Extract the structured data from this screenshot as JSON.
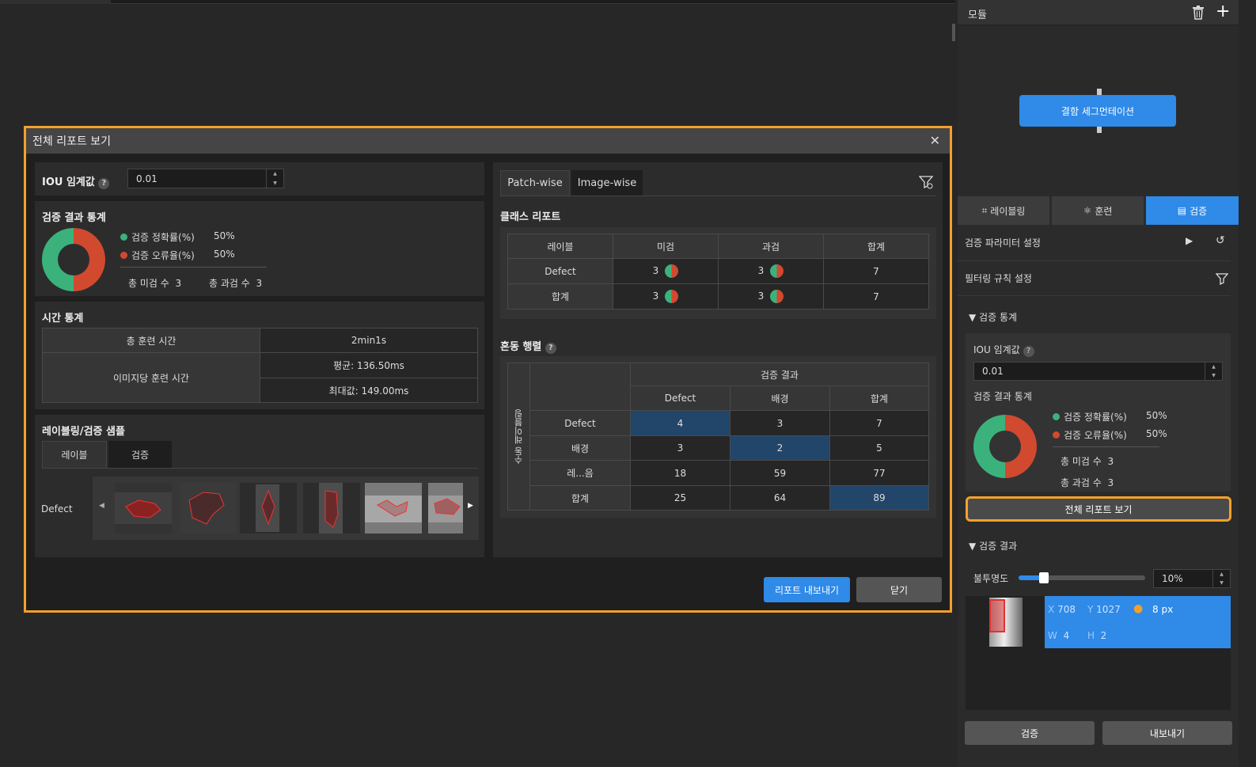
{
  "right_panel": {
    "title": "모듈",
    "node_label": "결함 세그먼테이션",
    "tabs": [
      {
        "label": "레이블링",
        "icon": "labeling-icon"
      },
      {
        "label": "훈련",
        "icon": "training-icon"
      },
      {
        "label": "검증",
        "icon": "validation-icon"
      }
    ],
    "param_setting": "검증 파라미터 설정",
    "filter_setting": "필터링 규칙 설정",
    "stats_section": "검증 통계",
    "iou_label": "IOU 임계값",
    "iou_value": "0.01",
    "result_stats": "검증 결과 통계",
    "accuracy_label": "검증 정확률(%)",
    "accuracy_value": "50%",
    "error_label": "검증 오류율(%)",
    "error_value": "50%",
    "miss_label": "총 미검 수",
    "miss_value": "3",
    "over_label": "총 과검 수",
    "over_value": "3",
    "full_report_button": "전체 리포트 보기",
    "results_section": "검증 결과",
    "opacity_label": "불투명도",
    "opacity_value": "10%",
    "opacity_fraction": 0.1,
    "detail": {
      "x_label": "X",
      "x": "708",
      "y_label": "Y",
      "y": "1027",
      "size": "8 px",
      "w_label": "W",
      "w": "4",
      "h_label": "H",
      "h": "2"
    },
    "validate_button": "검증",
    "export_button": "내보내기"
  },
  "dialog": {
    "title": "전체 리포트 보기",
    "iou_label": "IOU 임계값",
    "iou_value": "0.01",
    "result_stats_title": "검증 결과 통계",
    "accuracy_label": "검증 정확률(%)",
    "accuracy_value": "50%",
    "error_label": "검증 오류율(%)",
    "error_value": "50%",
    "miss_label": "총 미검 수",
    "miss_value": "3",
    "over_label": "총 과검 수",
    "over_value": "3",
    "time_title": "시간 통계",
    "total_train_label": "총 훈련 시간",
    "total_train_value": "2min1s",
    "per_image_label": "이미지당 훈련 시간",
    "avg_value": "평균: 136.50ms",
    "max_value": "최대값: 149.00ms",
    "samples_title": "레이블링/검증 샘플",
    "sample_tabs": [
      "레이블",
      "검증"
    ],
    "sample_row_label": "Defect",
    "report_tabs": [
      "Patch-wise",
      "Image-wise"
    ],
    "class_report_title": "클래스 리포트",
    "class_headers": [
      "레이블",
      "미검",
      "과검",
      "합계"
    ],
    "class_rows": [
      {
        "label": "Defect",
        "miss": "3",
        "over": "3",
        "total": "7"
      },
      {
        "label": "합계",
        "miss": "3",
        "over": "3",
        "total": "7"
      }
    ],
    "confusion_title": "혼동 행렬",
    "confusion_col_title": "검증 결과",
    "confusion_row_title": "수동 레이블링",
    "confusion_cols": [
      "Defect",
      "배경",
      "합계"
    ],
    "confusion_rows": [
      {
        "label": "Defect",
        "values": [
          "4",
          "3",
          "7"
        ]
      },
      {
        "label": "배경",
        "values": [
          "3",
          "2",
          "5"
        ]
      },
      {
        "label": "레...음",
        "values": [
          "18",
          "59",
          "77"
        ]
      },
      {
        "label": "합계",
        "values": [
          "25",
          "64",
          "89"
        ]
      }
    ],
    "export_report_button": "리포트 내보내기",
    "close_button": "닫기"
  },
  "colors": {
    "accent": "#2f8ae8",
    "highlight": "#f3a02b",
    "accuracy": "#3bb27c",
    "error": "#d1492f"
  }
}
